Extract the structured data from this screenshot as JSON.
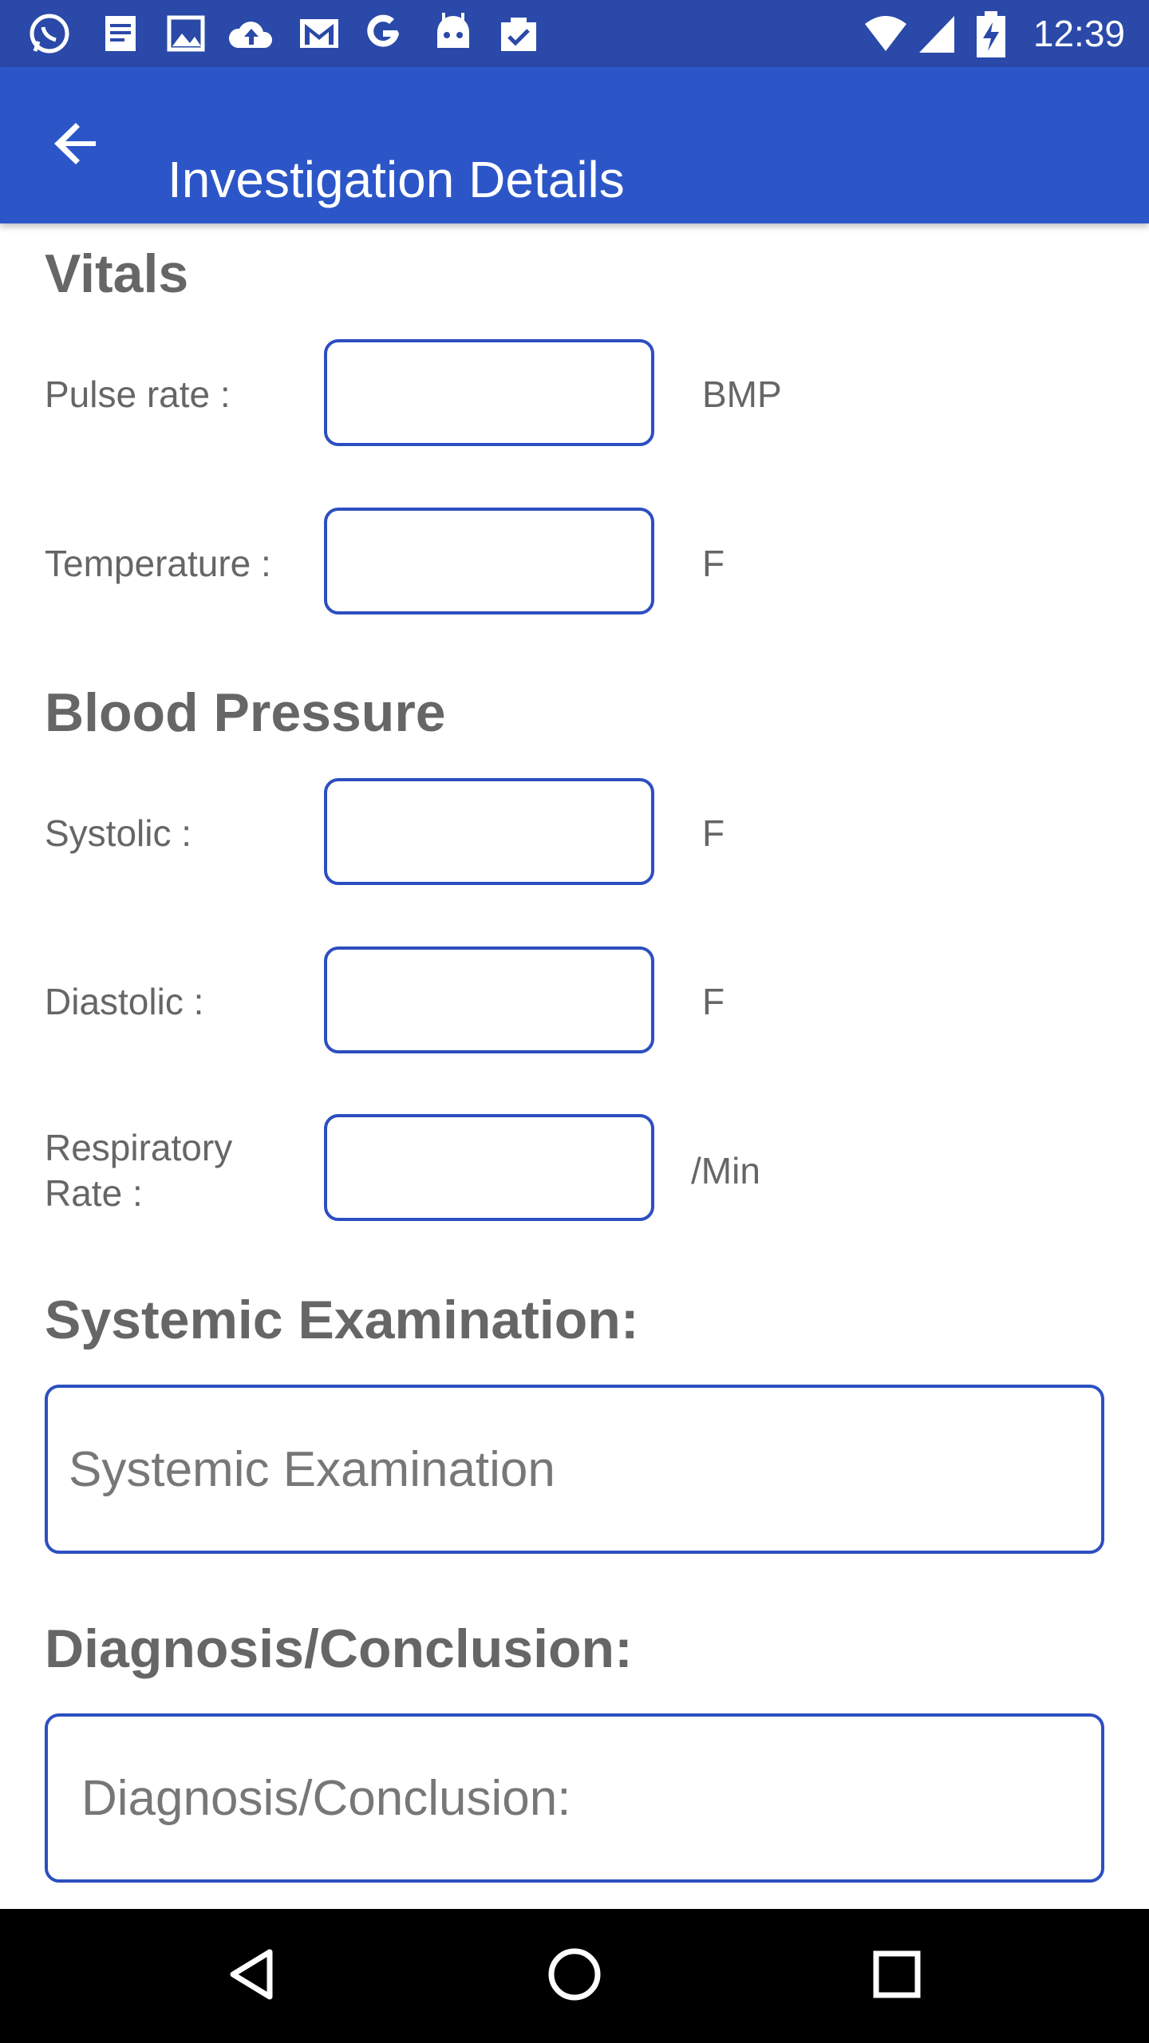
{
  "status_bar": {
    "time": "12:39",
    "left_icons": [
      "whatsapp-icon",
      "document-icon",
      "image-icon",
      "cloud-upload-icon",
      "gmail-icon",
      "google-icon",
      "android-icon",
      "clipboard-check-icon"
    ],
    "right_icons": [
      "wifi-icon",
      "signal-icon",
      "battery-charging-icon"
    ]
  },
  "app_bar": {
    "title": "Investigation Details",
    "back_icon": "arrow-back-icon"
  },
  "vitals": {
    "heading": "Vitals",
    "pulse_label": "Pulse rate :",
    "pulse_value": "",
    "pulse_unit": "BMP",
    "temperature_label": "Temperature :",
    "temperature_value": "",
    "temperature_unit": "F"
  },
  "blood_pressure": {
    "heading": "Blood Pressure",
    "systolic_label": "Systolic :",
    "systolic_value": "",
    "systolic_unit": "F",
    "diastolic_label": "Diastolic :",
    "diastolic_value": "",
    "diastolic_unit": "F",
    "respiratory_label_line1": "Respiratory",
    "respiratory_label_line2": "Rate :",
    "respiratory_value": "",
    "respiratory_unit": "/Min"
  },
  "systemic": {
    "heading": "Systemic Examination:",
    "placeholder": "Systemic Examination",
    "value": ""
  },
  "diagnosis": {
    "heading": "Diagnosis/Conclusion:",
    "placeholder": "Diagnosis/Conclusion:",
    "value": ""
  },
  "colors": {
    "status_bar": "#2a49a8",
    "app_bar": "#2c56c8",
    "input_border": "#2c4fc0",
    "label_text": "#666666",
    "nav_bar": "#000000"
  },
  "nav_bar": {
    "icons": [
      "back-triangle-icon",
      "home-circle-icon",
      "recents-square-icon"
    ]
  }
}
